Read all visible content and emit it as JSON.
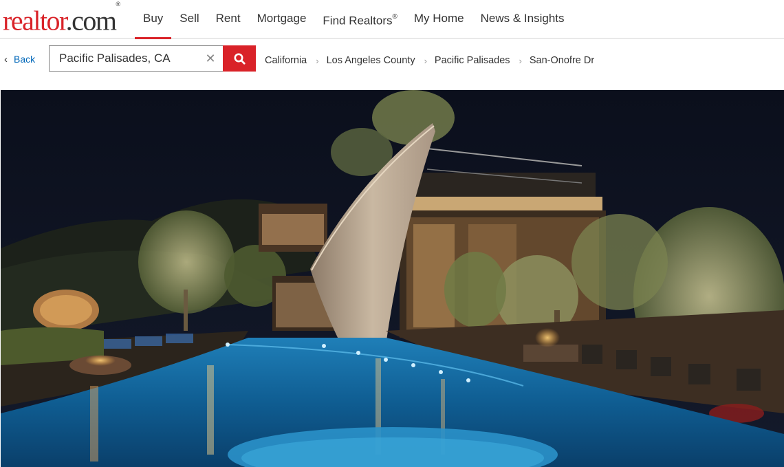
{
  "header": {
    "logo": {
      "text_main": "realtor",
      "text_suffix": ".com",
      "mark": "®"
    },
    "nav": [
      {
        "label": "Buy",
        "active": true
      },
      {
        "label": "Sell",
        "active": false
      },
      {
        "label": "Rent",
        "active": false
      },
      {
        "label": "Mortgage",
        "active": false
      },
      {
        "label": "Find Realtors",
        "sup": "®",
        "active": false
      },
      {
        "label": "My Home",
        "active": false
      },
      {
        "label": "News & Insights",
        "active": false
      }
    ]
  },
  "subbar": {
    "back_label": "Back",
    "search": {
      "value": "Pacific Palisades, CA",
      "clear_icon": "close-icon",
      "button_icon": "search-icon"
    },
    "breadcrumb": [
      "California",
      "Los Angeles County",
      "Pacific Palisades",
      "San-Onofre Dr"
    ]
  },
  "hero": {
    "subject": "night-view-modern-home-infinity-pool"
  },
  "colors": {
    "brand": "#d92228",
    "link": "#0067b9",
    "text": "#333333"
  }
}
